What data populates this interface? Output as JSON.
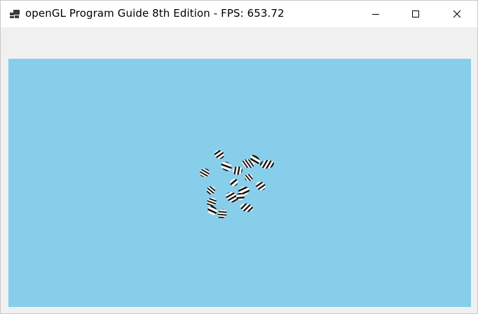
{
  "window": {
    "title": "openGL Program Guide 8th Edition - FPS: 653.72",
    "app_icon": "opengl-app-icon",
    "controls": {
      "minimize_icon": "minimize-icon",
      "maximize_icon": "maximize-icon",
      "close_icon": "close-icon"
    }
  },
  "viewport": {
    "clear_color": "#87ceeb",
    "object_color_dark": "#111111",
    "object_color_light": "#ffffff",
    "object_count": 18
  }
}
